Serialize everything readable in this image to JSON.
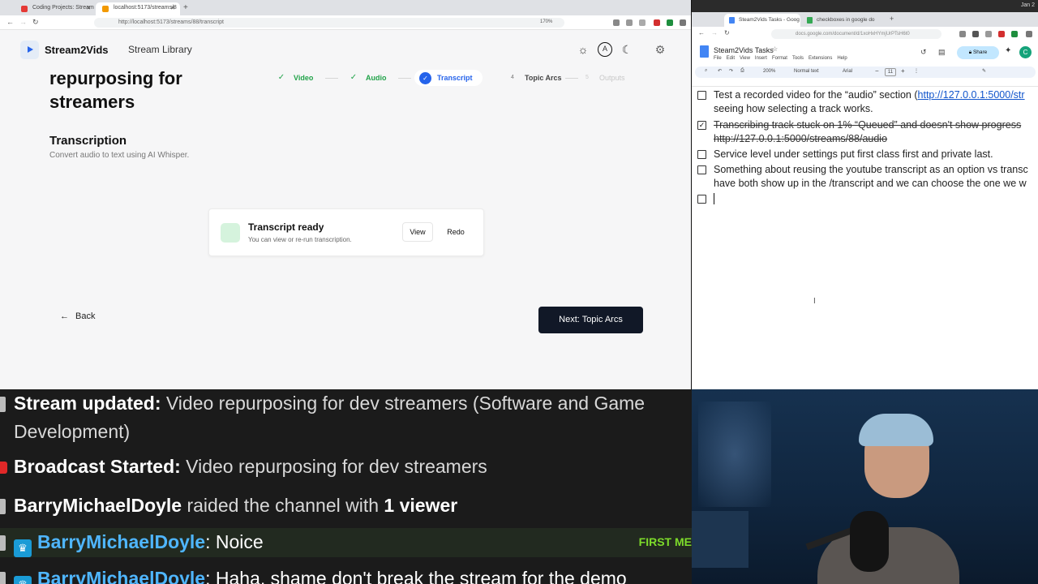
{
  "left_browser": {
    "tabs": [
      {
        "title": "Coding Projects: Stream",
        "favicon_color": "#e53935"
      },
      {
        "title": "localhost:5173/streams/8",
        "favicon_color": "#f29900"
      }
    ],
    "url": "http://localhost:5173/streams/88/transcript",
    "zoom": "170%"
  },
  "app": {
    "brand": "Stream2Vids",
    "nav_library": "Stream Library",
    "page_title_line1": "repurposing for",
    "page_title_line2": "streamers",
    "steps": [
      {
        "label": "Video",
        "state": "done"
      },
      {
        "label": "Audio",
        "state": "done"
      },
      {
        "label": "Transcript",
        "state": "active"
      },
      {
        "number": "4",
        "label": "Topic Arcs",
        "state": "pending"
      },
      {
        "number": "5",
        "label": "Outputs",
        "state": "disabled"
      }
    ],
    "section_title": "Transcription",
    "section_subtitle": "Convert audio to text using AI Whisper.",
    "card": {
      "title": "Transcript ready",
      "subtitle": "You can view or re-run transcription.",
      "view_label": "View",
      "redo_label": "Redo"
    },
    "back_label": "Back",
    "next_label": "Next: Topic Arcs",
    "accent_color": "#2563eb",
    "next_button_color": "#111827"
  },
  "chat": {
    "lines": [
      {
        "type": "stream_update",
        "bold": "Stream updated:",
        "text": " Video repurposing for dev streamers (Software and Game",
        "text2": "Development)"
      },
      {
        "type": "broadcast",
        "bold": "Broadcast Started:",
        "text": " Video repurposing for dev streamers"
      },
      {
        "type": "raid",
        "name": "BarryMichaelDoyle",
        "text": " raided the channel with ",
        "count": "1 viewer"
      },
      {
        "type": "message",
        "name": "BarryMichaelDoyle",
        "text": ": Noice",
        "badge": "FIRST ME"
      },
      {
        "type": "message",
        "name": "BarryMichaelDoyle",
        "text": ": Haha, shame don't break the stream for the demo"
      }
    ]
  },
  "right_browser": {
    "system_clock": "Jan 2",
    "tabs": [
      {
        "title": "Steam2Vids Tasks - Goog",
        "favicon_color": "#4285f4"
      },
      {
        "title": "checkboxes in google do",
        "favicon_color": "#34a853"
      }
    ],
    "url": "docs.google.com/document/d/1xoHxHYmjUrPTsH6t0",
    "doc_title": "Steam2Vids Tasks",
    "menu": [
      "File",
      "Edit",
      "View",
      "Insert",
      "Format",
      "Tools",
      "Extensions",
      "Help"
    ],
    "share_label": "Share",
    "avatar_initial": "C",
    "toolbar": {
      "zoom": "200%",
      "style": "Normal text",
      "font": "Arial",
      "size": "11"
    },
    "items": [
      {
        "checked": false,
        "line1_prefix": "Test a recorded video for the “audio” section (",
        "line1_link": "http://127.0.0.1:5000/str",
        "line2": "seeing how selecting a track works."
      },
      {
        "checked": true,
        "line1": "Transcribing track stuck on 1% “Queued” and doesn't show progress",
        "line2": "http://127.0.0.1:5000/streams/88/audio"
      },
      {
        "checked": false,
        "line1": "Service level under settings put first class first and private last."
      },
      {
        "checked": false,
        "line1": "Something about reusing the youtube transcript as an option vs transc",
        "line2": "have both show up in the /transcript and we can choose the one we w"
      },
      {
        "checked": false,
        "line1": ""
      }
    ]
  }
}
